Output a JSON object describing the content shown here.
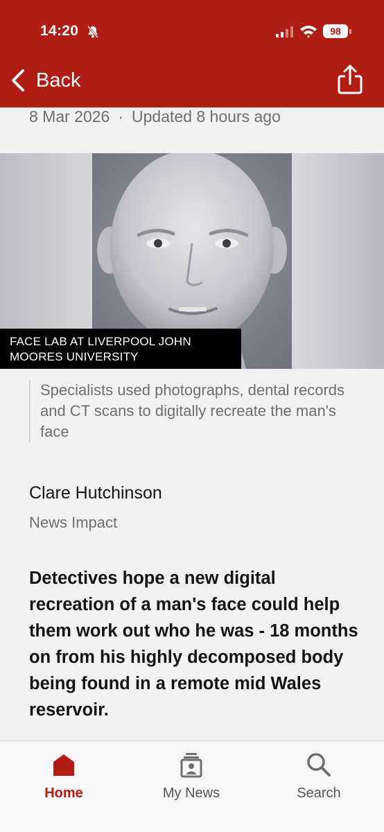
{
  "status_bar": {
    "time": "14:20",
    "battery": "98",
    "icons": [
      "bell-slash-icon",
      "signal-icon",
      "wifi-icon",
      "battery-icon"
    ]
  },
  "nav": {
    "back_label": "Back",
    "share_icon": "share-icon"
  },
  "article": {
    "date": "8 Mar 2026",
    "separator": "·",
    "updated": "Updated 8 hours ago",
    "image_credit": "FACE LAB AT LIVERPOOL JOHN MOORES UNIVERSITY",
    "caption": "Specialists used photographs, dental records and CT scans to digitally recreate the man's face",
    "author": "Clare Hutchinson",
    "author_role": "News Impact",
    "lead": "Detectives hope a new digital recreation of a man's face could help them work out who he was - 18 months on from his highly decomposed body being found in a remote mid Wales reservoir."
  },
  "tabbar": {
    "items": [
      {
        "label": "Home",
        "icon": "home-icon",
        "active": true
      },
      {
        "label": "My News",
        "icon": "my-news-icon",
        "active": false
      },
      {
        "label": "Search",
        "icon": "search-icon",
        "active": false
      }
    ]
  },
  "colors": {
    "brand_red": "#b11d14",
    "background": "#f2f2f2",
    "muted_text": "#6e6e6e"
  }
}
